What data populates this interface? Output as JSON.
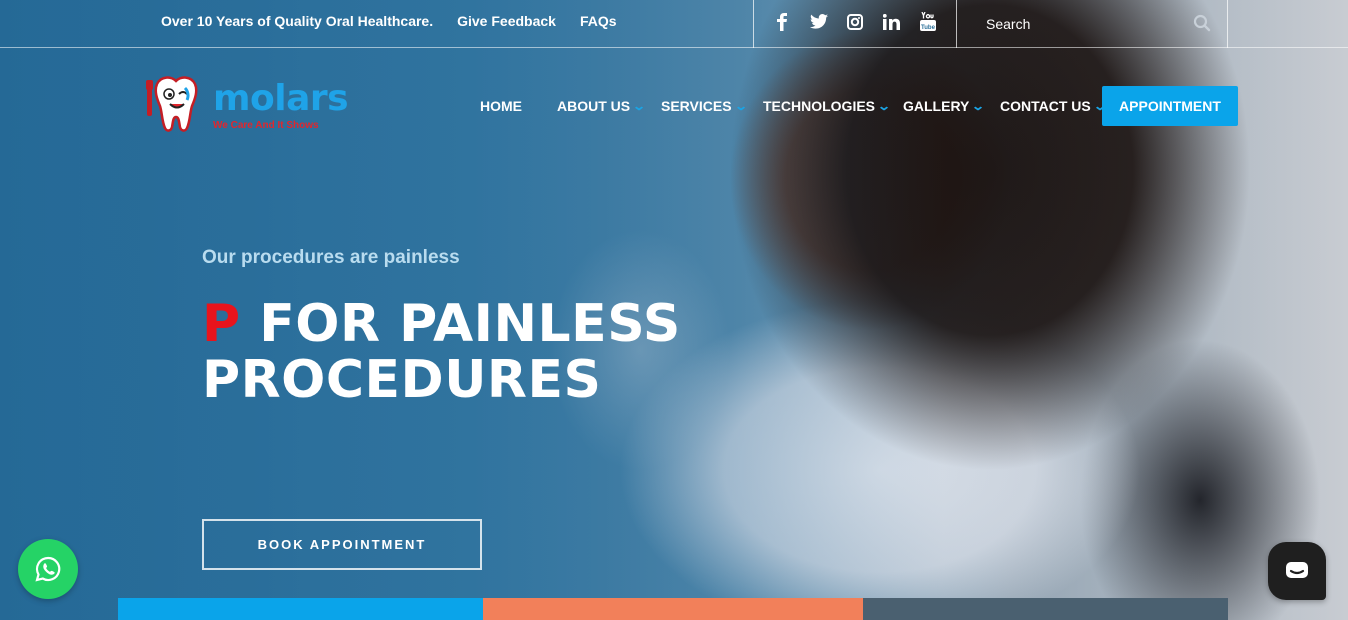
{
  "topbar": {
    "links": [
      "Over 10 Years of Quality Oral Healthcare.",
      "Give Feedback",
      "FAQs"
    ],
    "social": [
      "facebook-icon",
      "twitter-icon",
      "instagram-icon",
      "linkedin-icon",
      "youtube-icon"
    ],
    "search": {
      "placeholder": "Search"
    }
  },
  "logo": {
    "name": "molars",
    "tagline": "We Care And It Shows"
  },
  "nav": {
    "items": [
      {
        "label": "HOME",
        "dropdown": false
      },
      {
        "label": "ABOUT US",
        "dropdown": true
      },
      {
        "label": "SERVICES",
        "dropdown": true
      },
      {
        "label": "TECHNOLOGIES",
        "dropdown": true
      },
      {
        "label": "GALLERY",
        "dropdown": true
      },
      {
        "label": "CONTACT US",
        "dropdown": true
      }
    ],
    "cta": "APPOINTMENT"
  },
  "hero": {
    "eyebrow": "Our procedures are painless",
    "headline_first": "P",
    "headline_rest_line1": " FOR PAINLESS",
    "headline_line2": "PROCEDURES",
    "button": "BOOK APPOINTMENT"
  },
  "colors": {
    "accent": "#0aa4ea",
    "headline_red": "#e8141c",
    "strip_orange": "#f2805a",
    "strip_slate": "#4a6070",
    "whatsapp_green": "#25d366"
  }
}
